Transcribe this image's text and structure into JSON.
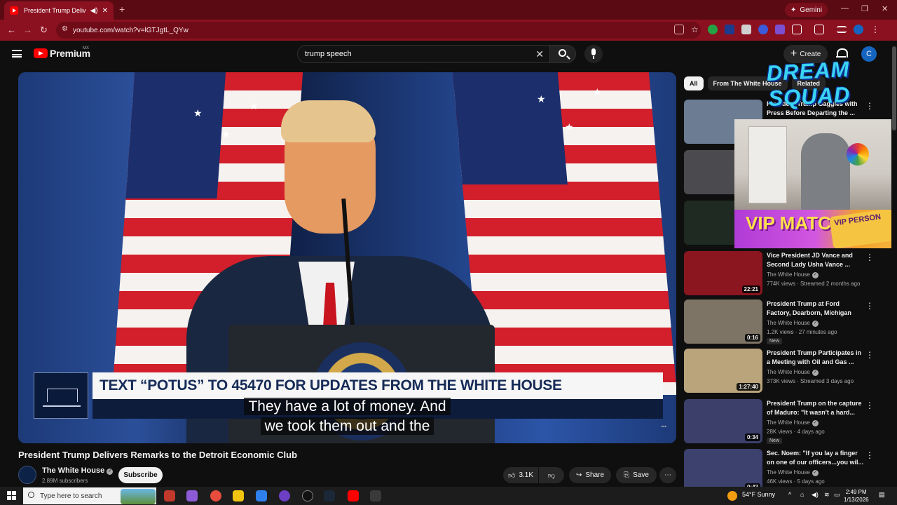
{
  "browser": {
    "tab_title": "President Trump Delivers Re",
    "url": "youtube.com/watch?v=lGTJgtL_QYw",
    "gemini_label": "Gemini"
  },
  "header": {
    "logo_text": "Premium",
    "logo_region": "MX",
    "search_value": "trump speech",
    "create_label": "Create",
    "avatar_letter": "C"
  },
  "video": {
    "lower_third": "TEXT “POTUS” TO 45470 FOR UPDATES FROM THE WHITE HOUSE",
    "caption_line1": "They have a lot of money. And",
    "caption_line2": "we took them out and the",
    "title": "President Trump Delivers Remarks to the Detroit Economic Club",
    "channel": "The White House",
    "subscribers": "2.89M subscribers",
    "subscribe_label": "Subscribe",
    "likes": "3.1K",
    "share_label": "Share",
    "save_label": "Save"
  },
  "chips": [
    "All",
    "From The White House",
    "Related"
  ],
  "recommendations": [
    {
      "title": "President Trump Gaggles with Press Before Departing the ...",
      "channel": "",
      "meta": "",
      "duration": "",
      "new": "",
      "thumb": "#6b7c93"
    },
    {
      "title": "",
      "channel": "",
      "meta": "",
      "duration": "",
      "new": "",
      "thumb": "#4b4a4f"
    },
    {
      "title": "",
      "channel": "",
      "meta": "",
      "duration": "",
      "new": "",
      "thumb": "#1e2a22"
    },
    {
      "title": "Vice President JD Vance and Second Lady Usha Vance ...",
      "channel": "The White House",
      "meta": "774K views · Streamed 2 months ago",
      "duration": "22:21",
      "new": "",
      "thumb": "#8c1620"
    },
    {
      "title": "President Trump at Ford Factory, Dearborn, Michigan",
      "channel": "The White House",
      "meta": "1.2K views · 27 minutes ago",
      "duration": "0:16",
      "new": "New",
      "thumb": "#7d7466"
    },
    {
      "title": "President Trump Participates in a Meeting with Oil and Gas ...",
      "channel": "The White House",
      "meta": "373K views · Streamed 3 days ago",
      "duration": "1:27:40",
      "new": "",
      "thumb": "#b9a47c"
    },
    {
      "title": "President Trump on the capture of Maduro: \"It wasn't a hard...",
      "channel": "The White House",
      "meta": "28K views · 4 days ago",
      "duration": "0:34",
      "new": "New",
      "thumb": "#3b3f6a"
    },
    {
      "title": "Sec. Noem: \"If you lay a finger on one of our officers...you wil...",
      "channel": "The White House",
      "meta": "46K views · 5 days ago",
      "duration": "0:43",
      "new": "",
      "thumb": "#3d416e"
    }
  ],
  "overlay": {
    "banner": "DREAM SQUAD",
    "vip_text": "VIP MATCHING",
    "vip_card": "VIP PERSON"
  },
  "taskbar": {
    "search_placeholder": "Type here to search",
    "weather": "54°F  Sunny",
    "time": "2:49 PM",
    "date": "1/13/2026"
  },
  "colors": {
    "browser_frame": "#8b1120",
    "youtube_red": "#ff0000",
    "page_bg": "#0f0f0f"
  }
}
